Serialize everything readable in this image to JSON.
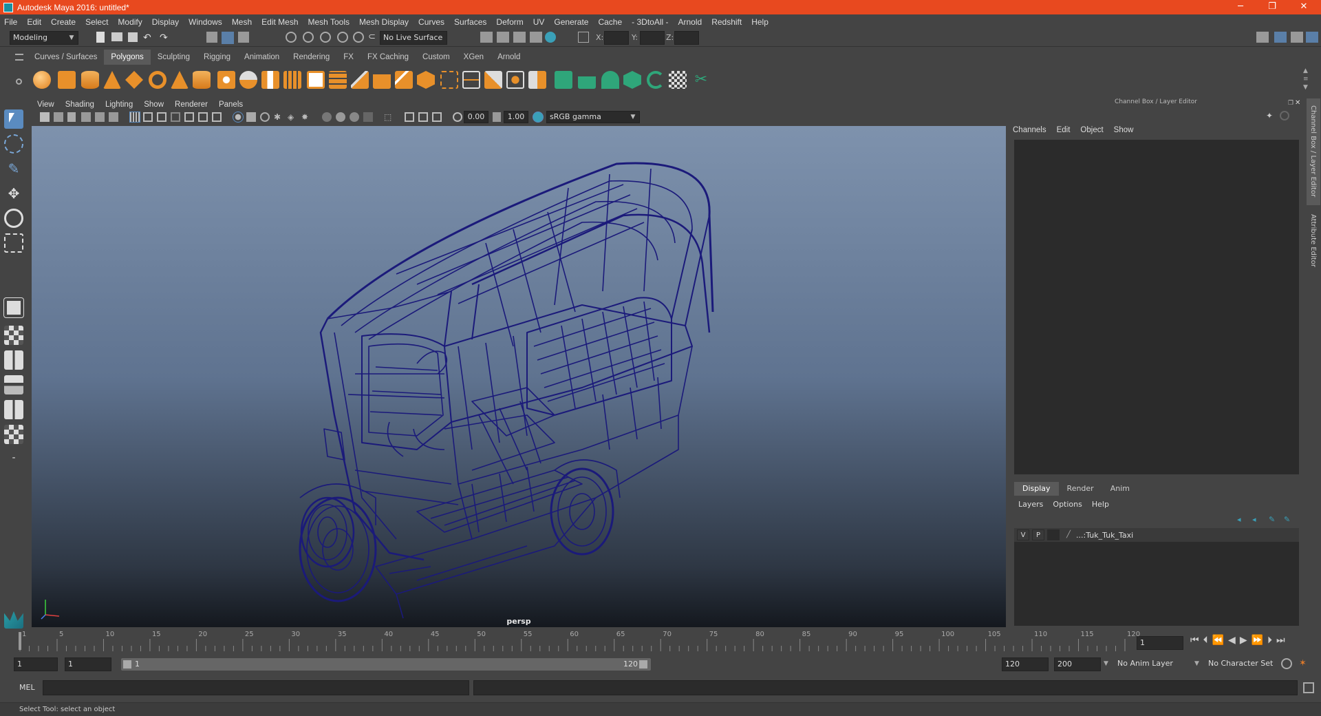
{
  "window": {
    "title": "Autodesk Maya 2016: untitled*",
    "minimize": "─",
    "maximize": "❐",
    "close": "✕"
  },
  "menus": [
    "File",
    "Edit",
    "Create",
    "Select",
    "Modify",
    "Display",
    "Windows",
    "Mesh",
    "Edit Mesh",
    "Mesh Tools",
    "Mesh Display",
    "Curves",
    "Surfaces",
    "Deform",
    "UV",
    "Generate",
    "Cache",
    "- 3DtoAll -",
    "Arnold",
    "Redshift",
    "Help"
  ],
  "statusline": {
    "mode": "Modeling",
    "live_surface": "No Live Surface",
    "x_label": "X:",
    "y_label": "Y:",
    "z_label": "Z:"
  },
  "shelf_tabs": [
    "Curves / Surfaces",
    "Polygons",
    "Sculpting",
    "Rigging",
    "Animation",
    "Rendering",
    "FX",
    "FX Caching",
    "Custom",
    "XGen",
    "Arnold"
  ],
  "shelf_active": "Polygons",
  "viewport": {
    "menus": [
      "View",
      "Shading",
      "Lighting",
      "Show",
      "Renderer",
      "Panels"
    ],
    "exposure": "0.00",
    "gamma": "1.00",
    "colorspace": "sRGB gamma",
    "camera": "persp"
  },
  "channel_box": {
    "title": "Channel Box / Layer Editor",
    "menus": [
      "Channels",
      "Edit",
      "Object",
      "Show"
    ]
  },
  "layer_editor": {
    "tabs": [
      "Display",
      "Render",
      "Anim"
    ],
    "active_tab": "Display",
    "menus": [
      "Layers",
      "Options",
      "Help"
    ],
    "layers": [
      {
        "v": "V",
        "p": "P",
        "name": "...:Tuk_Tuk_Taxi"
      }
    ]
  },
  "side_tabs": [
    "Channel Box / Layer Editor",
    "Attribute Editor"
  ],
  "timeline": {
    "ticks": [
      1,
      5,
      10,
      15,
      20,
      25,
      30,
      35,
      40,
      45,
      50,
      55,
      60,
      65,
      70,
      75,
      80,
      85,
      90,
      95,
      100,
      105,
      110,
      115,
      120
    ],
    "current_frame": "1"
  },
  "range": {
    "start": "1",
    "playback_start": "1",
    "slider_start": "1",
    "slider_end": "120",
    "playback_end": "120",
    "end": "200",
    "anim_layer": "No Anim Layer",
    "character_set": "No Character Set"
  },
  "mel": {
    "label": "MEL"
  },
  "help_line": "Select Tool: select an object",
  "colors": {
    "titlebar": "#e8491f",
    "wireframe": "#1b1a7a",
    "active_tab": "#5a5a5a"
  }
}
